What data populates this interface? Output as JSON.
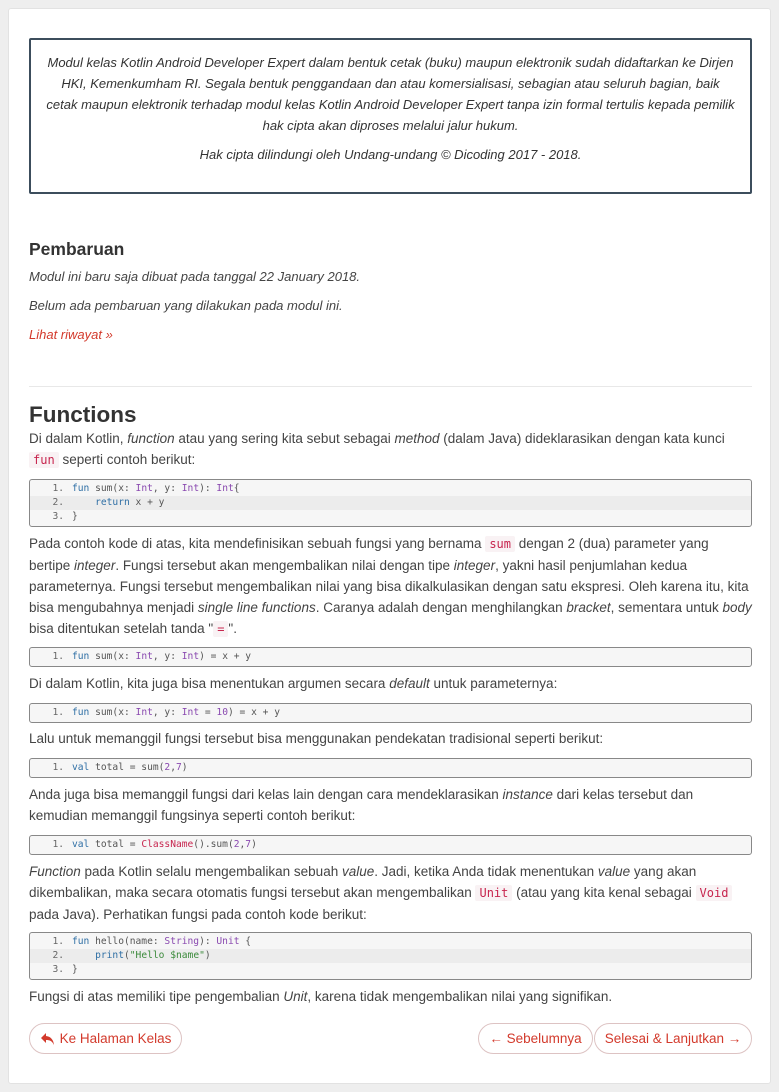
{
  "copyright": {
    "paragraph1": "Modul kelas Kotlin Android Developer Expert dalam bentuk cetak (buku) maupun elektronik sudah didaftarkan ke Dirjen HKI, Kemenkumham RI. Segala bentuk penggandaan dan atau komersialisasi, sebagian atau seluruh bagian, baik cetak maupun elektronik terhadap modul kelas Kotlin Android Developer Expert tanpa izin formal tertulis kepada pemilik hak cipta akan diproses melalui jalur hukum.",
    "paragraph2": "Hak cipta dilindungi oleh Undang-undang © Dicoding 2017 - 2018."
  },
  "update": {
    "title": "Pembaruan",
    "created": "Modul ini baru saja dibuat pada tanggal 22 January 2018.",
    "no_updates": "Belum ada pembaruan yang dilakukan pada modul ini.",
    "history_link": "Lihat riwayat »"
  },
  "section": {
    "title": "Functions",
    "p1": {
      "a": "Di dalam Kotlin, ",
      "b": "function",
      "c": " atau yang sering kita sebut sebagai ",
      "d": "method",
      "e": " (dalam Java) dideklarasikan dengan kata kunci ",
      "code": "fun",
      "f": " seperti contoh berikut:"
    },
    "p2": {
      "a": "Pada contoh kode di atas, kita mendefinisikan sebuah fungsi yang bernama ",
      "code1": "sum",
      "b": " dengan 2 (dua) parameter yang bertipe ",
      "c": "integer",
      "d": ". Fungsi tersebut akan mengembalikan nilai dengan tipe ",
      "e": "integer",
      "f": ", yakni hasil penjumlahan kedua parameternya. Fungsi tersebut mengembalikan nilai yang bisa dikalkulasikan dengan satu ekspresi. Oleh karena itu, kita bisa mengubahnya menjadi ",
      "g": "single line functions",
      "h": ". Caranya adalah dengan menghilangkan ",
      "i": "bracket",
      "j": ", sementara untuk ",
      "k": "body",
      "l": " bisa ditentukan setelah tanda \"",
      "code2": "=",
      "m": "\"."
    },
    "p3": {
      "a": "Di dalam Kotlin, kita juga bisa menentukan argumen secara ",
      "b": "default",
      "c": " untuk parameternya:"
    },
    "p4": "Lalu untuk memanggil fungsi tersebut bisa menggunakan pendekatan tradisional seperti berikut:",
    "p5": {
      "a": "Anda juga bisa memanggil fungsi dari kelas lain dengan cara mendeklarasikan ",
      "b": "instance",
      "c": " dari kelas tersebut dan kemudian memanggil fungsinya seperti contoh berikut:"
    },
    "p6": {
      "a": "Function",
      "b": " pada Kotlin selalu mengembalikan sebuah ",
      "c": "value",
      "d": ". Jadi, ketika Anda tidak menentukan ",
      "e": "value",
      "f": " yang akan dikembalikan, maka secara otomatis fungsi tersebut akan mengembalikan ",
      "code1": "Unit",
      "g": " (atau yang kita kenal sebagai ",
      "code2": "Void",
      "h": " pada Java). Perhatikan fungsi pada contoh kode berikut:"
    },
    "p7": {
      "a": "Fungsi di atas memiliki tipe pengembalian ",
      "b": "Unit",
      "c": ", karena tidak mengembalikan nilai yang signifikan."
    }
  },
  "code_blocks": {
    "b1": [
      {
        "n": "1.",
        "t": "fun sum(x: Int, y: Int): Int{"
      },
      {
        "n": "2.",
        "t": "    return x + y"
      },
      {
        "n": "3.",
        "t": "}"
      }
    ],
    "b2": [
      {
        "n": "1.",
        "t": "fun sum(x: Int, y: Int) = x + y"
      }
    ],
    "b3": [
      {
        "n": "1.",
        "t": "fun sum(x: Int, y: Int = 10) = x + y"
      }
    ],
    "b4": [
      {
        "n": "1.",
        "t": "val total = sum(2,7)"
      }
    ],
    "b5": [
      {
        "n": "1.",
        "t": "val total = ClassName().sum(2,7)"
      }
    ],
    "b6": [
      {
        "n": "1.",
        "t": "fun hello(name: String): Unit {"
      },
      {
        "n": "2.",
        "t": "    print(\"Hello $name\")"
      },
      {
        "n": "3.",
        "t": "}"
      }
    ]
  },
  "nav": {
    "back_label": "Ke Halaman Kelas",
    "prev_label": "← Sebelumnya",
    "next_label": "Selesai & Lanjutkan →"
  },
  "icons": {
    "back": "reply-arrow-icon"
  },
  "colors": {
    "accent": "#d33a2c",
    "code_inline": "#c7254e",
    "border_dark": "#3c4d5c"
  }
}
